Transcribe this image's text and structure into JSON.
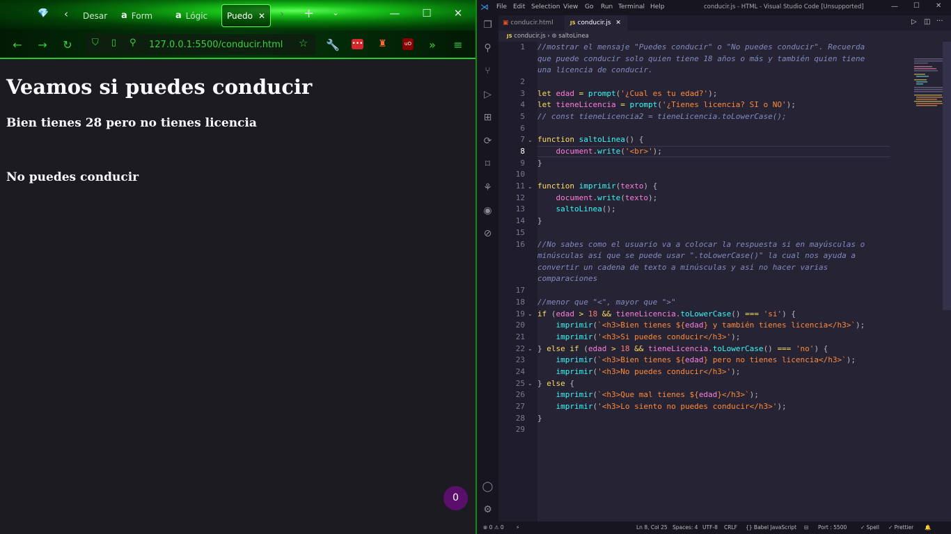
{
  "browser": {
    "tabs": [
      {
        "label": "Desarr"
      },
      {
        "label": "Form"
      },
      {
        "label": "Lógic"
      },
      {
        "label": "Puedo"
      }
    ],
    "url": "127.0.0.1:5500/conducir.html",
    "content": {
      "heading": "Veamos si puedes conducir",
      "line1": "Bien tienes 28 pero no tienes licencia",
      "line2": "No puedes conducir"
    },
    "badge": "0"
  },
  "vscode": {
    "menu": [
      "File",
      "Edit",
      "Selection",
      "View",
      "Go",
      "Run",
      "Terminal",
      "Help"
    ],
    "window_title": "conducir.js - HTML - Visual Studio Code [Unsupported]",
    "tabs": [
      {
        "label": "conducir.html",
        "icon": "html-file-icon"
      },
      {
        "label": "conducir.js",
        "icon": "js-file-icon",
        "active": true
      }
    ],
    "breadcrumb": {
      "file": "conducir.js",
      "symbol": "saltoLinea"
    },
    "line_numbers": [
      "1",
      "2",
      "3",
      "4",
      "5",
      "6",
      "7",
      "8",
      "9",
      "10",
      "11",
      "12",
      "13",
      "14",
      "15",
      "16",
      "17",
      "18",
      "19",
      "20",
      "21",
      "22",
      "23",
      "24",
      "25",
      "26",
      "27",
      "28",
      "29"
    ],
    "code": {
      "c1a": "//mostrar el mensaje \"Puedes conducir\" o \"No puedes conducir\". Recuerda",
      "c1b": "que puede conducir solo quien tiene 18 años o más y también quien tiene",
      "c1c": "una licencia de conducir.",
      "l3_str": "'¿Cual es tu edad?'",
      "l4_str": "'¿Tienes licencia? SI o NO'",
      "l5": "// const tieneLicencia2 = tieneLicencia.toLowerCase();",
      "l8_str": "'<br>'",
      "c16a": "//No sabes como el usuario va a colocar la respuesta si en mayúsculas o",
      "c16b": "minúsculas así que se puede usar \".toLowerCase()\" la cual nos ayuda a",
      "c16c": "convertir un cadena de texto a minúsculas y así no hacer varias",
      "c16d": "comparaciones",
      "l18": "//menor que \"<\", mayor que \">\"",
      "l20_a": "`<h3>Bien tienes ${",
      "l20_b": "} y también tienes licencia</h3>`",
      "l21": "'<h3>Si puedes conducir</h3>'",
      "l23_a": "`<h3>Bien tienes ${",
      "l23_b": "} pero no tienes licencia</h3>`",
      "l24": "'<h3>No puedes conducir</h3>'",
      "l26_a": "`<h3>Que mal tienes ${",
      "l26_b": "}</h3>`",
      "l27": "'<h3>Lo siento no puedes conducir</h3>'"
    },
    "status": {
      "problems": "⊗ 0 ⚠ 0",
      "position": "Ln 8, Col 25",
      "spaces": "Spaces: 4",
      "encoding": "UTF-8",
      "eol": "CRLF",
      "language": "{} Babel JavaScript",
      "port": "Port : 5500",
      "spell": "✓ Spell",
      "prettier": "✓ Prettier"
    }
  },
  "colors": {
    "browser_accent": "#3ad13e",
    "vscode_bg": "#262335",
    "keyword": "#fede5d",
    "variable": "#ff7edb",
    "function": "#36f9f6",
    "string": "#ff8b39",
    "comment": "#848bbd"
  }
}
